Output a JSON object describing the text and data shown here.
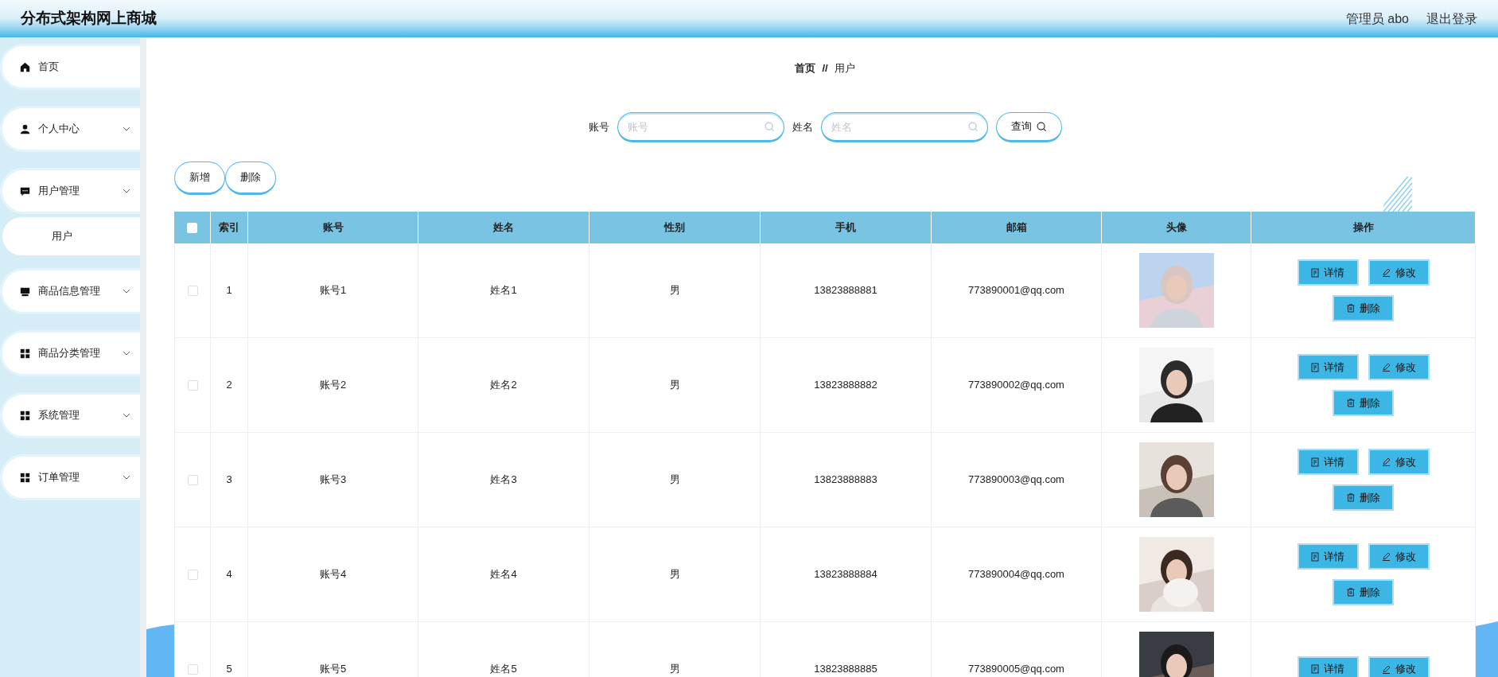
{
  "header": {
    "title": "分布式架构网上商城",
    "user": "管理员 abo",
    "logout": "退出登录"
  },
  "sidebar": {
    "items": [
      {
        "label": "首页",
        "has_submenu": false
      },
      {
        "label": "个人中心",
        "has_submenu": true
      },
      {
        "label": "用户管理",
        "has_submenu": true,
        "children": [
          {
            "label": "用户",
            "selected": true
          }
        ]
      },
      {
        "label": "商品信息管理",
        "has_submenu": true
      },
      {
        "label": "商品分类管理",
        "has_submenu": true
      },
      {
        "label": "系统管理",
        "has_submenu": true
      },
      {
        "label": "订单管理",
        "has_submenu": true
      }
    ]
  },
  "breadcrumb": {
    "home": "首页",
    "separator": "//",
    "current": "用户"
  },
  "search": {
    "fields": [
      {
        "label": "账号",
        "placeholder": "账号"
      },
      {
        "label": "姓名",
        "placeholder": "姓名"
      }
    ],
    "button": "查询"
  },
  "toolbar": {
    "buttons": [
      "新增",
      "删除"
    ]
  },
  "table": {
    "header_checked": false,
    "columns": [
      "索引",
      "账号",
      "姓名",
      "性别",
      "手机",
      "邮箱",
      "头像",
      "操作"
    ],
    "rows": [
      {
        "checked": false,
        "cells": [
          "1",
          "账号1",
          "姓名1",
          "男",
          "13823888881",
          "773890001@qq.com"
        ],
        "avatar": {
          "kind": "picture"
        },
        "actions": [
          "详情",
          "修改",
          "删除"
        ]
      },
      {
        "checked": false,
        "cells": [
          "2",
          "账号2",
          "姓名2",
          "男",
          "13823888882",
          "773890002@qq.com"
        ],
        "avatar": {
          "kind": "picture"
        },
        "actions": [
          "详情",
          "修改",
          "删除"
        ]
      },
      {
        "checked": false,
        "cells": [
          "3",
          "账号3",
          "姓名3",
          "男",
          "13823888883",
          "773890003@qq.com"
        ],
        "avatar": {
          "kind": "picture"
        },
        "actions": [
          "详情",
          "修改",
          "删除"
        ]
      },
      {
        "checked": false,
        "cells": [
          "4",
          "账号4",
          "姓名4",
          "男",
          "13823888884",
          "773890004@qq.com"
        ],
        "avatar": {
          "kind": "picture"
        },
        "actions": [
          "详情",
          "修改",
          "删除"
        ]
      },
      {
        "checked": false,
        "cells": [
          "5",
          "账号5",
          "姓名5",
          "男",
          "13823888885",
          "773890005@qq.com"
        ],
        "avatar": {
          "kind": "picture"
        },
        "actions": [
          "详情",
          "修改"
        ]
      }
    ]
  }
}
